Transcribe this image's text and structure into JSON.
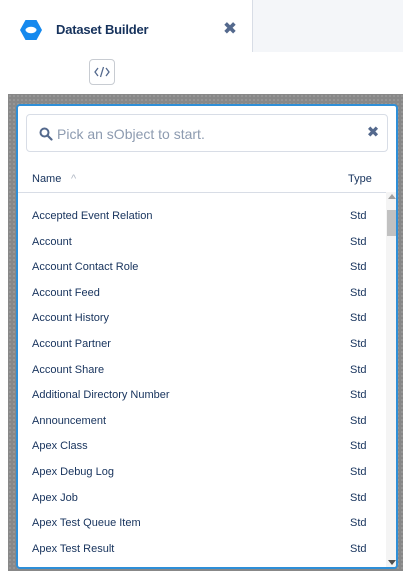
{
  "tab": {
    "title": "Dataset Builder",
    "close_glyph": "✖",
    "logo_icon": "hexagon-logo-icon",
    "accent": "#1589ee"
  },
  "toolbar": {
    "list_icon": "list-view-icon",
    "code_icon": "code-view-icon"
  },
  "search": {
    "placeholder": "Pick an sObject to start.",
    "value": "",
    "clear_glyph": "✖"
  },
  "table": {
    "col_name": "Name",
    "col_type": "Type",
    "sort_glyph": "^",
    "rows": [
      {
        "name": "Accepted Event Relation",
        "type": "Std"
      },
      {
        "name": "Account",
        "type": "Std"
      },
      {
        "name": "Account Contact Role",
        "type": "Std"
      },
      {
        "name": "Account Feed",
        "type": "Std"
      },
      {
        "name": "Account History",
        "type": "Std"
      },
      {
        "name": "Account Partner",
        "type": "Std"
      },
      {
        "name": "Account Share",
        "type": "Std"
      },
      {
        "name": "Additional Directory Number",
        "type": "Std"
      },
      {
        "name": "Announcement",
        "type": "Std"
      },
      {
        "name": "Apex Class",
        "type": "Std"
      },
      {
        "name": "Apex Debug Log",
        "type": "Std"
      },
      {
        "name": "Apex Job",
        "type": "Std"
      },
      {
        "name": "Apex Test Queue Item",
        "type": "Std"
      },
      {
        "name": "Apex Test Result",
        "type": "Std"
      }
    ]
  }
}
